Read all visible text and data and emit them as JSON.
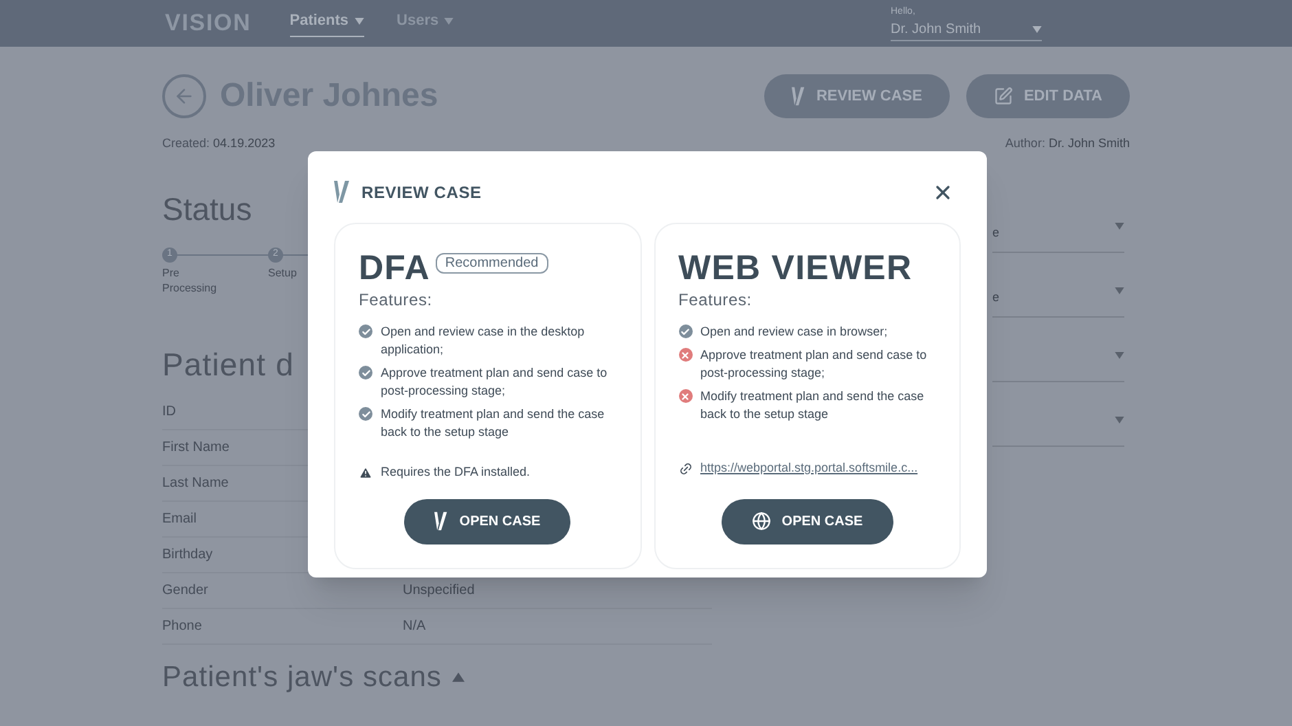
{
  "topbar": {
    "logo": "VISION",
    "nav": [
      {
        "label": "Patients",
        "selected": true
      },
      {
        "label": "Users",
        "selected": false
      }
    ],
    "greeting": "Hello,",
    "user": "Dr. John Smith"
  },
  "header": {
    "name": "Oliver Johnes",
    "buttons": [
      {
        "label": "REVIEW CASE",
        "kind": "logo"
      },
      {
        "label": "EDIT DATA",
        "kind": "edit"
      }
    ]
  },
  "meta": {
    "created_label": "Created:",
    "created": "04.19.2023",
    "author_label": "Author:",
    "author": "Dr. John Smith"
  },
  "status": {
    "title": "Status",
    "steps": [
      {
        "number": "1",
        "label": "Pre Processing"
      },
      {
        "number": "2",
        "label": "Setup"
      }
    ]
  },
  "patient": {
    "title": "Patient d",
    "fields": [
      {
        "label": "ID"
      },
      {
        "label": "First Name"
      },
      {
        "label": "Last Name"
      },
      {
        "label": "Email"
      },
      {
        "label": "Birthday"
      },
      {
        "label": "Gender",
        "value": "Unspecified"
      },
      {
        "label": "Phone",
        "value": "N/A"
      }
    ]
  },
  "dropdowns": [
    {
      "kind": "select",
      "value": "e"
    },
    {
      "kind": "select",
      "value": "e"
    },
    {
      "kind": "select"
    },
    {
      "kind": "select"
    }
  ],
  "scans": {
    "title": "Patient's jaw's scans",
    "expanded": true
  },
  "modal": {
    "title": "REVIEW CASE",
    "options": [
      {
        "title": "DFA",
        "badge": "Recommended",
        "subtitle": "Features:",
        "features": [
          {
            "text": "Open and review case in the desktop application;",
            "available": true
          },
          {
            "text": "Approve treatment plan and send case to post-processing stage;",
            "available": true
          },
          {
            "text": "Modify treatment plan and send the case back to the setup stage",
            "available": true
          }
        ],
        "note": {
          "kind": "warning",
          "text": "Requires the DFA installed."
        },
        "button": {
          "label": "OPEN CASE",
          "kind": "logo"
        }
      },
      {
        "title": "WEB VIEWER",
        "subtitle": "Features:",
        "features": [
          {
            "text": "Open and review case in browser;",
            "available": true
          },
          {
            "text": "Approve treatment plan and send case to post-processing stage;",
            "available": false
          },
          {
            "text": "Modify treatment plan and send the case back to the setup stage",
            "available": false
          }
        ],
        "note": {
          "kind": "link",
          "text": "https://webportal.stg.portal.softsmile.c..."
        },
        "button": {
          "label": "OPEN CASE",
          "kind": "globe"
        }
      }
    ]
  }
}
